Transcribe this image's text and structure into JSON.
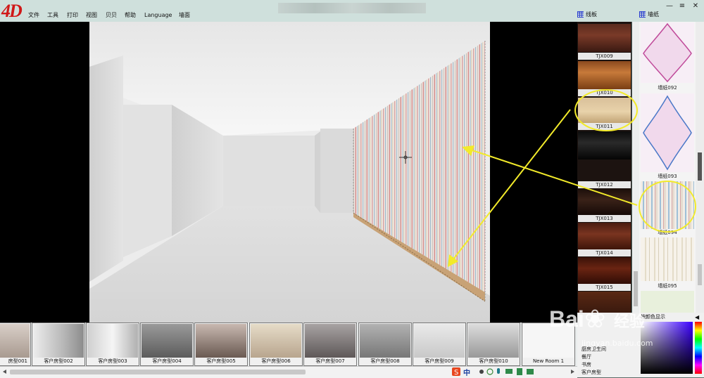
{
  "app": {
    "logo": "4D",
    "menu": [
      "文件",
      "工具",
      "打印",
      "视图",
      "贝贝",
      "帮助",
      "Language",
      "墙面"
    ],
    "window_controls": [
      "—",
      "≡",
      "✕"
    ]
  },
  "panels": {
    "line_board": {
      "title": "线板",
      "items": [
        "TJX009",
        "TJX010",
        "TJX011",
        "TJX012",
        "TJX013",
        "TJX014",
        "TJX015"
      ]
    },
    "wallpaper": {
      "title": "墙纸",
      "items": [
        "墙纸092",
        "墙纸093",
        "墙纸094",
        "墙纸095"
      ]
    }
  },
  "room_types": [
    "厨房卫生间",
    "餐厅",
    "书房",
    "客户房型"
  ],
  "color_panel": {
    "title": "按颜色显示"
  },
  "thumbnails": [
    "房型001",
    "客户房型002",
    "客户房型003",
    "客户房型004",
    "客户房型005",
    "客户房型006",
    "客户房型007",
    "客户房型008",
    "客户房型009",
    "客户房型010",
    "New Room 1"
  ],
  "watermark": {
    "brand": "Bai",
    "brand_cn": "经验",
    "url": "jingyan.baidu.com"
  },
  "taskbar": [
    "中"
  ],
  "colors": {
    "menubar": "#cfe0dc",
    "highlight": "#f2ea2a",
    "logo": "#d01818"
  },
  "icons": [
    "grid-icon",
    "crosshair-icon",
    "sogou-ime-icon"
  ]
}
